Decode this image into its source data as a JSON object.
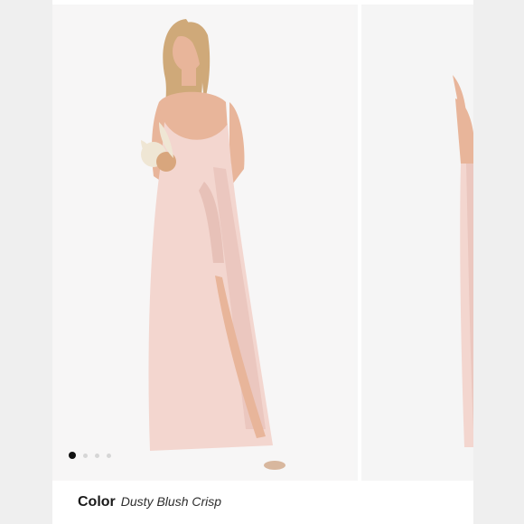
{
  "product": {
    "color_label": "Color",
    "color_value": "Dusty Blush Crisp"
  },
  "gallery": {
    "dots": [
      true,
      false,
      false,
      false
    ]
  },
  "colors": {
    "dress": "#f3d6cf",
    "dress_shadow": "#e7c1b8",
    "skin": "#e8b59a",
    "hair": "#cfa979",
    "bouquet": "#efe6d4"
  }
}
